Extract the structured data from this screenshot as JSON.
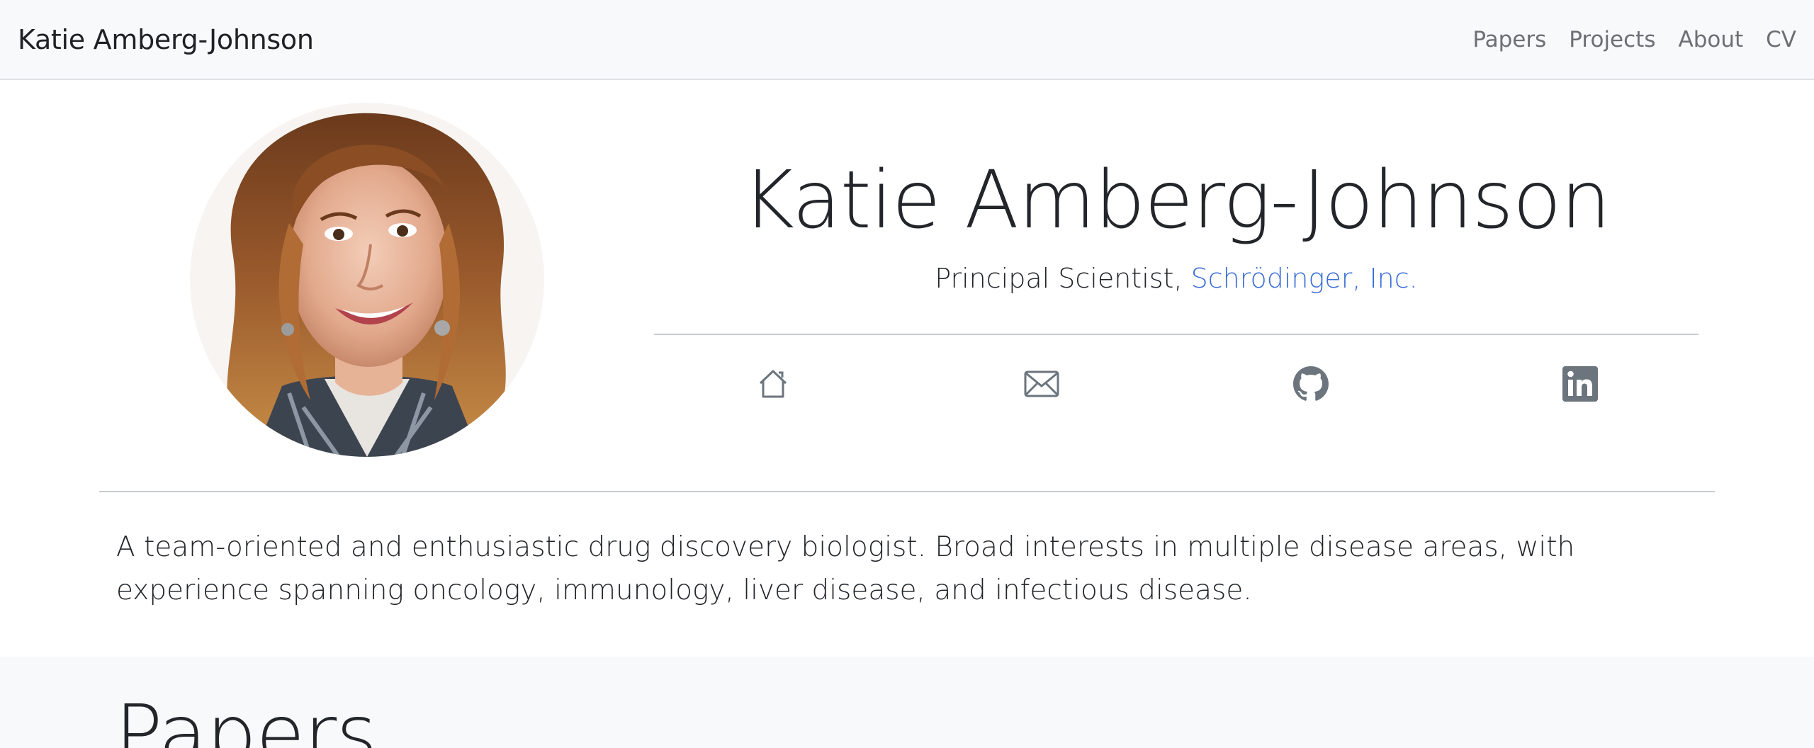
{
  "navbar": {
    "brand": "Katie Amberg-Johnson",
    "links": [
      {
        "label": "Papers"
      },
      {
        "label": "Projects"
      },
      {
        "label": "About"
      },
      {
        "label": "CV"
      }
    ]
  },
  "hero": {
    "name": "Katie Amberg-Johnson",
    "title_prefix": "Principal Scientist, ",
    "company": "Schrödinger, Inc.",
    "social_icons": [
      "home-icon",
      "envelope-icon",
      "github-icon",
      "linkedin-icon"
    ]
  },
  "bio": "A team-oriented and enthusiastic drug discovery biologist. Broad interests in multiple disease areas, with experience spanning oncology, immunology, liver disease, and infectious disease.",
  "papers": {
    "heading": "Papers"
  },
  "colors": {
    "link": "#3a6ed6",
    "navbar_bg": "#f8f9fa",
    "text": "#222529",
    "icon": "#6c757d"
  }
}
